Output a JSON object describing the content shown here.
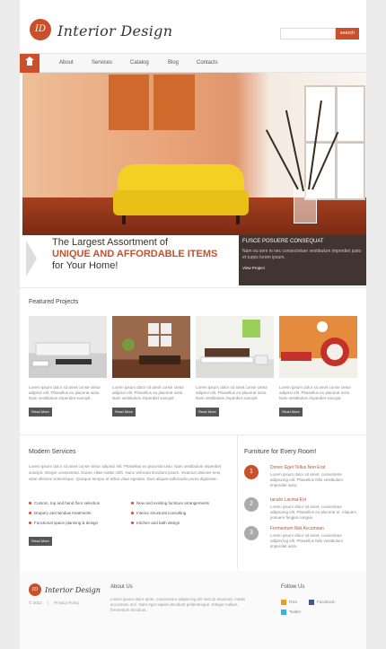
{
  "header": {
    "logo_mark": "ID",
    "logo_text": "Interior Design",
    "search_placeholder": "",
    "search_button": "search"
  },
  "nav": {
    "items": [
      {
        "label": "About"
      },
      {
        "label": "Services"
      },
      {
        "label": "Catalog"
      },
      {
        "label": "Blog"
      },
      {
        "label": "Contacts"
      }
    ]
  },
  "banner": {
    "line1": "The Largest Assortment of",
    "line2": "UNIQUE AND AFFORDABLE ITEMS",
    "line3": "for Your Home!",
    "box_title": "FUSCE POSUERE CONSEQUAT",
    "box_text": "Nam eu sem in nec consectetuer vestibulum imperdiet justo et turpis lorem ipsum.",
    "box_link": "View Project"
  },
  "featured": {
    "title": "Featured Projects",
    "projects": [
      {
        "text": "Lorem ipsum dolor sit amet conse ctetur adipisci elit. Phasellus eu placerat iusto. Nam vestibulum imperdiet suscipit.",
        "button": "Read More"
      },
      {
        "text": "Lorem ipsum dolor sit amet conse ctetur adipisci elit. Phasellus eu placerat iusto. Nam vestibulum imperdiet suscipit.",
        "button": "Read More"
      },
      {
        "text": "Lorem ipsum dolor sit amet conse ctetur adipisci elit. Phasellus eu placerat iusto. Nam vestibulum imperdiet suscipit.",
        "button": "Read More"
      },
      {
        "text": "Lorem ipsum dolor sit amet conse ctetur adipisci elit. Phasellus eu placerat iusto. Nam vestibulum imperdiet suscipit.",
        "button": "Read More"
      }
    ]
  },
  "services": {
    "title": "Modern Services",
    "text": "Lorem ipsum dolor sit amet conse ctetur adipisci elit. Phasellus eu placerat iusto. Nam vestibulum imperdiet suscipit. Integer consectetur. Donec vitae mattis nibh. Nunc vehicula tincidunt ipsum. Vivamus ultricies eros vitae ultricies scelerisque. Quisque tempor et tellus vitae egestas. Duis aliquet sollicitudin purus dignissim.",
    "list_left": [
      "Custom, top and hand floor selection",
      "Drapery and window treatments",
      "Functional space planning & design"
    ],
    "list_right": [
      "New and existing furniture arrangements",
      "Interior structural consulting",
      "Kitchen and bath design"
    ],
    "button": "Read More"
  },
  "features": {
    "title": "Furniture for Every Room!",
    "items": [
      {
        "num": "1",
        "title": "Donec Eget Tellus Non Erat",
        "text": "Lorem ipsum dolor sit amet, consectetur adipiscing elit. Phasellus felis vestibulum imperdiet iusto."
      },
      {
        "num": "2",
        "title": "Iaculis Lacinia Est",
        "text": "Lorem ipsum dolor sit amet, consectetur adipiscing elit. Phasellus eu placerat ut. Aliquam posuere feugiat congue."
      },
      {
        "num": "3",
        "title": "Fermentum Nisl Accumsan",
        "text": "Lorem ipsum dolor sit amet, consectetur adipiscing elit. Phasellus felis vestibulum imperdiet iusto."
      }
    ]
  },
  "footer": {
    "logo_mark": "ID",
    "logo_text": "Interior Design",
    "copyright": "© 2012",
    "separator": "|",
    "privacy": "Privacy Policy",
    "about_title": "About Us",
    "about_text": "Lorem ipsum dolor amet, consectetur adipiscing elit sed do eiusmod, mattis accumsan orci. Nam eget sapien tincidunt pellentesque. Integer nullam, fermentum tincidunt.",
    "follow_title": "Follow Us",
    "social": [
      {
        "label": "RSS"
      },
      {
        "label": "Facebook"
      },
      {
        "label": "Twitter"
      }
    ]
  },
  "colors": {
    "accent": "#c8502b",
    "dark": "#555555",
    "circle_gray": "#aaaaaa"
  }
}
